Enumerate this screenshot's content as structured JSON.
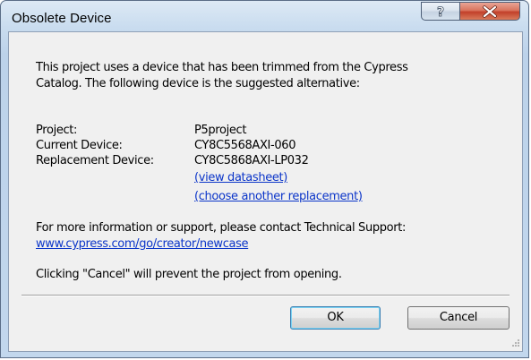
{
  "window": {
    "title": "Obsolete Device",
    "help_icon": "help-icon",
    "close_icon": "close-icon"
  },
  "dialog": {
    "intro_line1": "This project uses a device that has been trimmed from the Cypress",
    "intro_line2": "Catalog. The following device is the suggested alternative:",
    "project_label": "Project:",
    "project_value": "P5project",
    "current_device_label": "Current Device:",
    "current_device_value": "CY8C5568AXI-060",
    "replacement_label": "Replacement Device:",
    "replacement_value": "CY8C5868AXI-LP032",
    "view_datasheet_link": "(view datasheet)",
    "choose_replacement_link": "(choose another replacement)",
    "support_text": "For more information or support, please contact Technical Support:",
    "support_link": "www.cypress.com/go/creator/newcase",
    "cancel_note": "Clicking \"Cancel\" will prevent the project from opening."
  },
  "buttons": {
    "ok_label": "OK",
    "cancel_label": "Cancel"
  },
  "colors": {
    "link": "#0b35c9",
    "dialog_bg": "#f0f0f0",
    "close_button": "#c2402a"
  }
}
